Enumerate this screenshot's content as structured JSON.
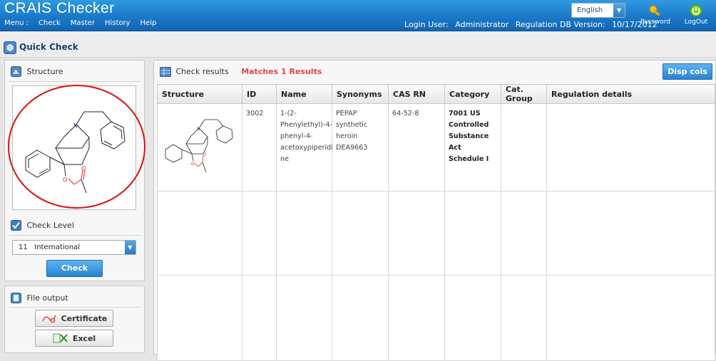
{
  "app": {
    "title": "CRAIS Checker",
    "menu_prefix": "Menu :",
    "menu": [
      "Check",
      "Master",
      "History",
      "Help"
    ],
    "login_label": "Login User:",
    "login_user": "Administrator",
    "db_label": "Regulation DB Version:",
    "db_version": "10/17/2012",
    "language": "English",
    "password_label": "Password",
    "logout_label": "LogOut"
  },
  "page": {
    "title": "Quick Check"
  },
  "structure_panel": {
    "title": "Structure"
  },
  "check_level": {
    "title": "Check Level",
    "selected": "11   International",
    "check_button": "Check"
  },
  "file_output": {
    "title": "File output",
    "certificate_button": "Certificate",
    "excel_button": "Excel"
  },
  "results": {
    "title": "Check results",
    "matches": "Matches 1 Results",
    "disp_cols_button": "Disp cols",
    "columns": [
      "Structure",
      "ID",
      "Name",
      "Synonyms",
      "CAS RN",
      "Category",
      "Cat. Group",
      "Regulation details"
    ],
    "rows": [
      {
        "id": "3002",
        "name": [
          "1-(2-",
          "Phenylethyl)-4-",
          "phenyl-4-",
          "acetoxypiperidi",
          "ne"
        ],
        "synonyms": [
          "PEPAP",
          "synthetic",
          "heroin",
          "DEA9663"
        ],
        "cas_rn": "64-52-8",
        "category": [
          "7001 US",
          "Controlled",
          "Substance",
          "Act",
          "Schedule I"
        ],
        "cat_group": "",
        "regulation_details": ""
      }
    ]
  },
  "colors": {
    "header_blue": "#1a79c9",
    "accent_red": "#e04a4a",
    "title_navy": "#16407a"
  },
  "icons": [
    "quick-check-icon",
    "structure-icon",
    "checkbox-icon",
    "file-icon",
    "results-grid-icon",
    "certificate-icon",
    "excel-icon",
    "password-key-icon",
    "logout-power-icon"
  ]
}
